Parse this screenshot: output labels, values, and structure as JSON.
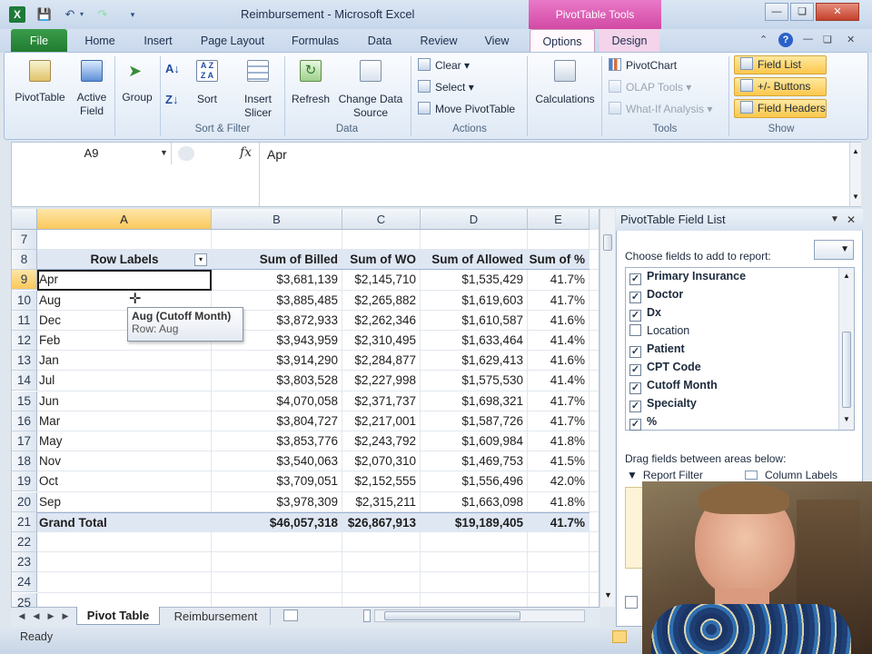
{
  "window": {
    "title": "Reimbursement - Microsoft Excel",
    "context_group": "PivotTable Tools"
  },
  "tabs": [
    "File",
    "Home",
    "Insert",
    "Page Layout",
    "Formulas",
    "Data",
    "Review",
    "View",
    "Options",
    "Design"
  ],
  "ribbon": {
    "pivottable": "PivotTable",
    "active_field": [
      "Active",
      "Field"
    ],
    "group": "Group",
    "sort": "Sort",
    "insert_slicer": [
      "Insert",
      "Slicer"
    ],
    "refresh": "Refresh",
    "change_source": [
      "Change Data",
      "Source"
    ],
    "clear": "Clear",
    "select": "Select",
    "move_pivot": "Move PivotTable",
    "calculations": "Calculations",
    "pivotchart": "PivotChart",
    "olap": "OLAP Tools",
    "whatif": "What-If Analysis",
    "field_list": "Field List",
    "buttons": "+/- Buttons",
    "field_headers": "Field Headers",
    "groups": [
      "Sort & Filter",
      "Data",
      "Actions",
      "Tools",
      "Show"
    ]
  },
  "formula_bar": {
    "name_box": "A9",
    "fx": "fx",
    "content": "Apr"
  },
  "columns": [
    "A",
    "B",
    "C",
    "D",
    "E"
  ],
  "pivot": {
    "header": [
      "Row Labels",
      "Sum of Billed",
      "Sum of WO",
      "Sum of Allowed",
      "Sum of %"
    ],
    "rows": [
      [
        "Apr",
        "$3,681,139",
        "$2,145,710",
        "$1,535,429",
        "41.7%"
      ],
      [
        "Aug",
        "$3,885,485",
        "$2,265,882",
        "$1,619,603",
        "41.7%"
      ],
      [
        "Dec",
        "$3,872,933",
        "$2,262,346",
        "$1,610,587",
        "41.6%"
      ],
      [
        "Feb",
        "$3,943,959",
        "$2,310,495",
        "$1,633,464",
        "41.4%"
      ],
      [
        "Jan",
        "$3,914,290",
        "$2,284,877",
        "$1,629,413",
        "41.6%"
      ],
      [
        "Jul",
        "$3,803,528",
        "$2,227,998",
        "$1,575,530",
        "41.4%"
      ],
      [
        "Jun",
        "$4,070,058",
        "$2,371,737",
        "$1,698,321",
        "41.7%"
      ],
      [
        "Mar",
        "$3,804,727",
        "$2,217,001",
        "$1,587,726",
        "41.7%"
      ],
      [
        "May",
        "$3,853,776",
        "$2,243,792",
        "$1,609,984",
        "41.8%"
      ],
      [
        "Nov",
        "$3,540,063",
        "$2,070,310",
        "$1,469,753",
        "41.5%"
      ],
      [
        "Oct",
        "$3,709,051",
        "$2,152,555",
        "$1,556,496",
        "42.0%"
      ],
      [
        "Sep",
        "$3,978,309",
        "$2,315,211",
        "$1,663,098",
        "41.8%"
      ]
    ],
    "total": [
      "Grand Total",
      "$46,057,318",
      "$26,867,913",
      "$19,189,405",
      "41.7%"
    ]
  },
  "row_numbers": [
    "7",
    "8",
    "9",
    "10",
    "11",
    "12",
    "13",
    "14",
    "15",
    "16",
    "17",
    "18",
    "19",
    "20",
    "21",
    "22",
    "23",
    "24",
    "25"
  ],
  "tooltip": {
    "title": "Aug (Cutoff Month)",
    "sub": "Row: Aug"
  },
  "sheets": [
    "Pivot Table",
    "Reimbursement"
  ],
  "status": "Ready",
  "field_list": {
    "title": "PivotTable Field List",
    "choose": "Choose fields to add to report:",
    "fields": [
      {
        "name": "Primary Insurance",
        "checked": true
      },
      {
        "name": "Doctor",
        "checked": true
      },
      {
        "name": "Dx",
        "checked": true
      },
      {
        "name": "Location",
        "checked": false
      },
      {
        "name": "Patient",
        "checked": true
      },
      {
        "name": "CPT Code",
        "checked": true
      },
      {
        "name": "Cutoff Month",
        "checked": true
      },
      {
        "name": "Specialty",
        "checked": true
      },
      {
        "name": "%",
        "checked": true
      }
    ],
    "drag": "Drag fields between areas below:",
    "report_filter": "Report Filter",
    "column_labels": "Column Labels"
  }
}
